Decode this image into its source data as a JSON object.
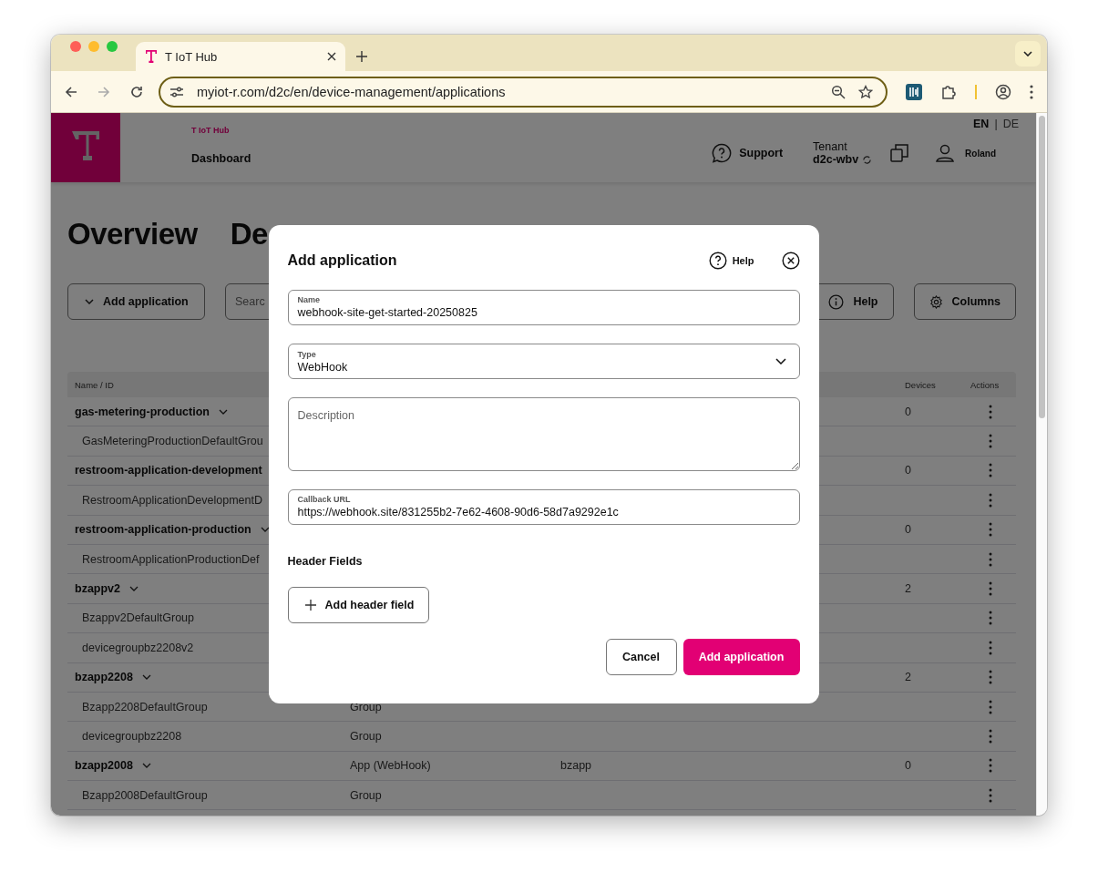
{
  "browser": {
    "tab_title": "T IoT Hub",
    "url": "myiot-r.com/d2c/en/device-management/applications"
  },
  "header": {
    "brand": "T IoT Hub",
    "nav": "Dashboard",
    "languages": [
      {
        "label": "EN",
        "selected": true
      },
      {
        "label": "DE",
        "selected": false
      }
    ],
    "language_separator": "|",
    "support": "Support",
    "tenant_label": "Tenant",
    "tenant_value": "d2c-wbv",
    "user": "Roland"
  },
  "page": {
    "tabs": [
      {
        "label": "Overview"
      },
      {
        "label": "De"
      }
    ],
    "toolbar": {
      "add_button": "Add application",
      "search_placeholder": "Searc",
      "help_button": "Help",
      "columns_button": "Columns"
    }
  },
  "table": {
    "columns": [
      {
        "label": "Name / ID"
      },
      {
        "label": "Devices"
      },
      {
        "label": "Actions"
      }
    ],
    "rows": [
      {
        "kind": "app",
        "name": "gas-metering-production",
        "devices": "0"
      },
      {
        "kind": "group",
        "name": "GasMeteringProductionDefaultGrou"
      },
      {
        "kind": "app",
        "name": "restroom-application-development",
        "devices": "0"
      },
      {
        "kind": "group",
        "name": "RestroomApplicationDevelopmentD"
      },
      {
        "kind": "app",
        "name": "restroom-application-production",
        "devices": "0"
      },
      {
        "kind": "group",
        "name": "RestroomApplicationProductionDef"
      },
      {
        "kind": "app",
        "name": "bzappv2",
        "devices": "2"
      },
      {
        "kind": "group",
        "name": "Bzappv2DefaultGroup"
      },
      {
        "kind": "group",
        "name": "devicegroupbz2208v2"
      },
      {
        "kind": "app",
        "name": "bzapp2208",
        "devices": "2"
      },
      {
        "kind": "group",
        "name": "Bzapp2208DefaultGroup",
        "type": "Group"
      },
      {
        "kind": "group",
        "name": "devicegroupbz2208",
        "type": "Group"
      },
      {
        "kind": "app",
        "name": "bzapp2008",
        "type": "App (WebHook)",
        "column_3": "bzapp",
        "devices": "0"
      },
      {
        "kind": "group",
        "name": "Bzapp2008DefaultGroup",
        "type": "Group"
      }
    ]
  },
  "dialog": {
    "title": "Add application",
    "help": "Help",
    "fields": [
      {
        "kind": "input",
        "label": "Name",
        "value": "webhook-site-get-started-20250825"
      },
      {
        "kind": "select",
        "label": "Type",
        "value": "WebHook"
      },
      {
        "kind": "textarea",
        "placeholder": "Description"
      },
      {
        "kind": "input",
        "label": "Callback URL",
        "value": "https://webhook.site/831255b2-7e62-4608-90d6-58d7a9292e1c"
      }
    ],
    "section_title": "Header Fields",
    "add_header_button": "Add header field",
    "cancel_button": "Cancel",
    "submit_button": "Add application"
  }
}
